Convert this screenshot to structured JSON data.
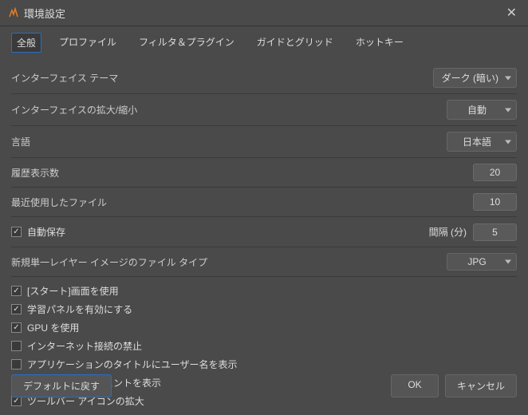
{
  "window": {
    "title": "環境設定"
  },
  "tabs": {
    "general": "全般",
    "profile": "プロファイル",
    "filters": "フィルタ＆プラグイン",
    "guides": "ガイドとグリッド",
    "hotkeys": "ホットキー"
  },
  "settings": {
    "theme": {
      "label": "インターフェイス テーマ",
      "value": "ダーク (暗い)"
    },
    "scale": {
      "label": "インターフェイスの拡大/縮小",
      "value": "自動"
    },
    "language": {
      "label": "言語",
      "value": "日本語"
    },
    "history": {
      "label": "履歴表示数",
      "value": "20"
    },
    "recent": {
      "label": "最近使用したファイル",
      "value": "10"
    },
    "autosave": {
      "label": "自動保存",
      "interval_label": "間隔 (分)",
      "interval_value": "5"
    },
    "newfiletype": {
      "label": "新規単一レイヤー イメージのファイル タイプ",
      "value": "JPG"
    }
  },
  "checks": {
    "start_screen": "[スタート]画面を使用",
    "learning_panel": "学習パネルを有効にする",
    "gpu": "GPU を使用",
    "no_internet": "インターネット接続の禁止",
    "title_username": "アプリケーションのタイトルにユーザー名を表示",
    "statusbar_hints": "ステータスバーにヒントを表示",
    "toolbar_icons": "ツールバー アイコンの拡大"
  },
  "footer": {
    "reset": "デフォルトに戻す",
    "ok": "OK",
    "cancel": "キャンセル"
  }
}
